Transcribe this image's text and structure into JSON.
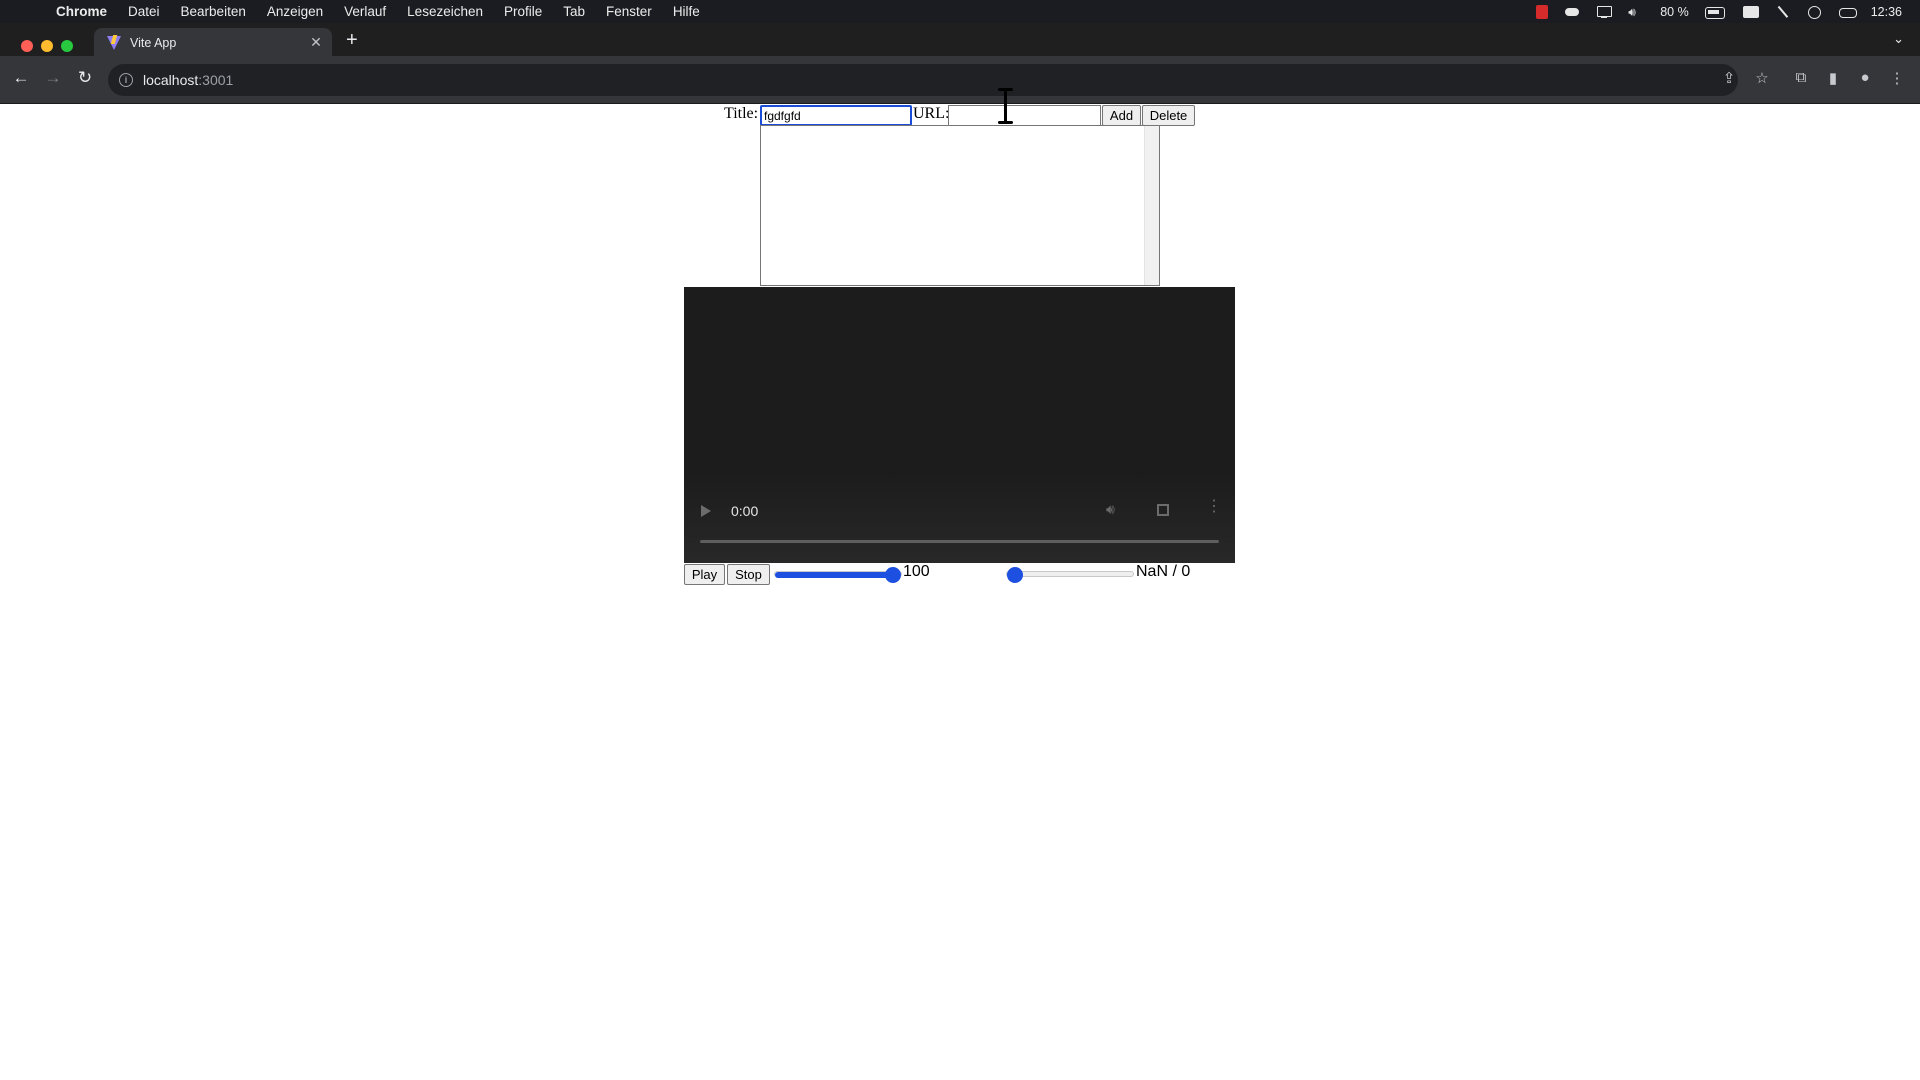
{
  "menubar": {
    "apple": "",
    "items": [
      "Chrome",
      "Datei",
      "Bearbeiten",
      "Anzeigen",
      "Verlauf",
      "Lesezeichen",
      "Profile",
      "Tab",
      "Fenster",
      "Hilfe"
    ],
    "battery": "80 %",
    "clock": "12:36"
  },
  "browser": {
    "tab_title": "Vite App",
    "tab_close": "✕",
    "new_tab": "+",
    "tab_list": "⌄",
    "url_host": "localhost",
    "url_port": ":3001"
  },
  "form": {
    "title_label": "Title:",
    "title_value": "fgdfgfd",
    "url_label": "URL:",
    "url_value": "",
    "add_label": "Add",
    "delete_label": "Delete"
  },
  "video": {
    "time": "0:00",
    "progress": 0
  },
  "controls": {
    "play_label": "Play",
    "stop_label": "Stop",
    "volume_value": "100",
    "volume_level": 1.0,
    "seek_level": 0.0,
    "time_readout": "NaN / 0"
  },
  "colors": {
    "accent": "#1d4fe0",
    "menubar_bg": "#1b1c22",
    "tabstrip_bg": "#1f1f1f",
    "toolbar_bg": "#35363a",
    "video_bg": "#1c1c1c"
  }
}
